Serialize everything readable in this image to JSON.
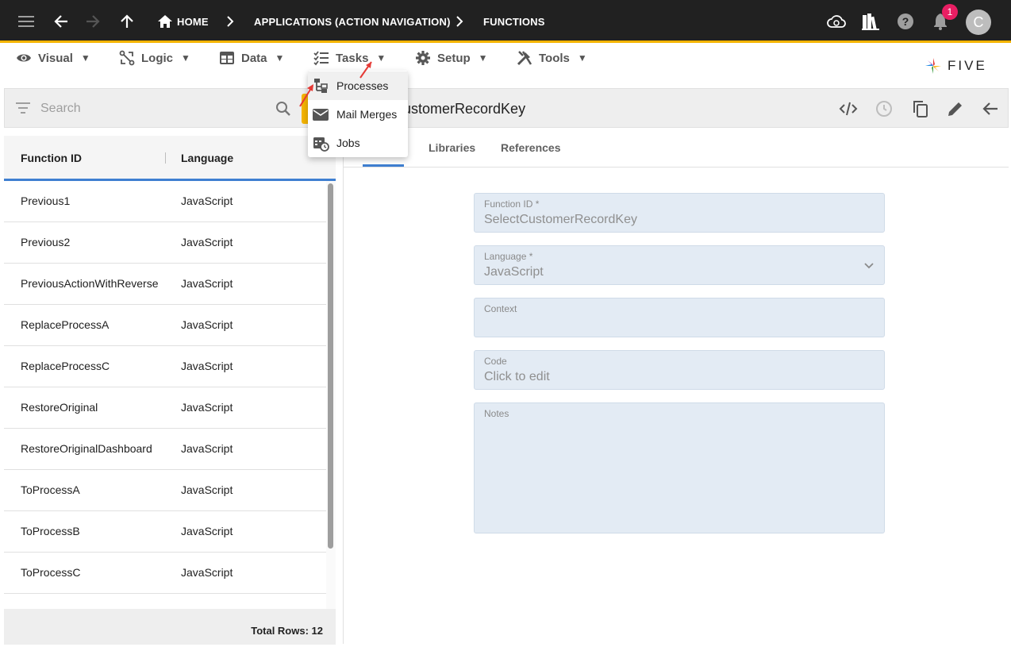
{
  "topbar": {
    "breadcrumbs": [
      "HOME",
      "APPLICATIONS (ACTION NAVIGATION)",
      "FUNCTIONS"
    ],
    "notification_count": "1",
    "avatar_initial": "C"
  },
  "menubar": {
    "items": [
      {
        "label": "Visual",
        "icon": "eye-icon"
      },
      {
        "label": "Logic",
        "icon": "logic-icon"
      },
      {
        "label": "Data",
        "icon": "table-icon"
      },
      {
        "label": "Tasks",
        "icon": "checklist-icon"
      },
      {
        "label": "Setup",
        "icon": "gear-icon"
      },
      {
        "label": "Tools",
        "icon": "tools-icon"
      }
    ],
    "logo_text": "FIVE"
  },
  "tasks_menu": {
    "items": [
      {
        "label": "Processes",
        "icon": "process-icon",
        "highlighted": true
      },
      {
        "label": "Mail Merges",
        "icon": "mail-icon"
      },
      {
        "label": "Jobs",
        "icon": "jobs-icon"
      }
    ]
  },
  "left_panel": {
    "search_placeholder": "Search",
    "columns": [
      "Function ID",
      "Language"
    ],
    "rows": [
      {
        "id": "Previous1",
        "language": "JavaScript"
      },
      {
        "id": "Previous2",
        "language": "JavaScript"
      },
      {
        "id": "PreviousActionWithReverse",
        "language": "JavaScript"
      },
      {
        "id": "ReplaceProcessA",
        "language": "JavaScript"
      },
      {
        "id": "ReplaceProcessC",
        "language": "JavaScript"
      },
      {
        "id": "RestoreOriginal",
        "language": "JavaScript"
      },
      {
        "id": "RestoreOriginalDashboard",
        "language": "JavaScript"
      },
      {
        "id": "ToProcessA",
        "language": "JavaScript"
      },
      {
        "id": "ToProcessB",
        "language": "JavaScript"
      },
      {
        "id": "ToProcessC",
        "language": "JavaScript"
      }
    ],
    "footer": "Total Rows: 12"
  },
  "right_panel": {
    "title": "ustomerRecordKey",
    "tabs": [
      "Libraries",
      "References"
    ],
    "fields": {
      "function_id": {
        "label": "Function ID *",
        "value": "SelectCustomerRecordKey"
      },
      "language": {
        "label": "Language *",
        "value": "JavaScript"
      },
      "context": {
        "label": "Context",
        "value": ""
      },
      "code": {
        "label": "Code",
        "value": "Click to edit"
      },
      "notes": {
        "label": "Notes",
        "value": ""
      }
    }
  },
  "colors": {
    "topbar_bg": "#212121",
    "accent_yellow": "#f4b400",
    "tab_indicator": "#3f7fd1",
    "field_bg": "#e3ebf4",
    "badge": "#e91e63",
    "annotation_arrow": "#e53935"
  }
}
